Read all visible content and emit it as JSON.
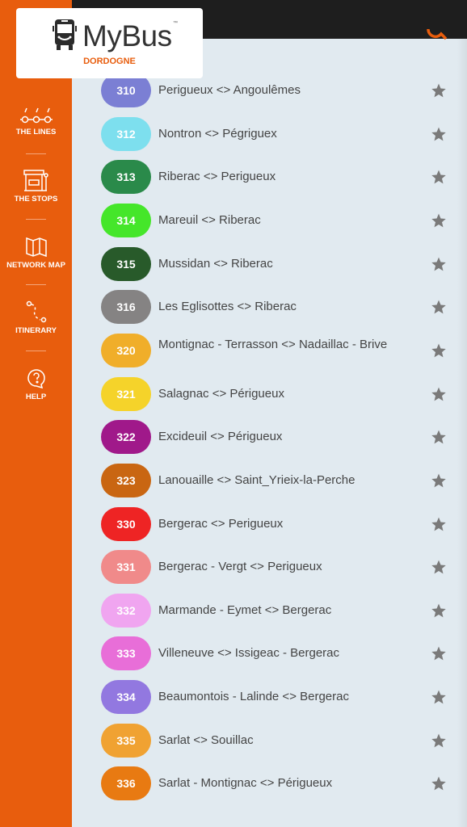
{
  "brand": {
    "name": "MyBus",
    "tm": "™",
    "region": "DORDOGNE"
  },
  "sidebar": {
    "items": [
      {
        "label": "THE LINES",
        "icon": "lines-icon"
      },
      {
        "label": "THE STOPS",
        "icon": "bus-stop-icon"
      },
      {
        "label": "NETWORK MAP",
        "icon": "map-icon"
      },
      {
        "label": "ITINERARY",
        "icon": "route-icon"
      },
      {
        "label": "HELP",
        "icon": "help-icon"
      }
    ]
  },
  "colors": {
    "accent": "#e85d0d",
    "star": "#7a7a7a"
  },
  "lines": [
    {
      "number": "310",
      "name": "Perigueux <> Angoulêmes",
      "color": "#7b7fd4"
    },
    {
      "number": "312",
      "name": "Nontron <> Pégriguex",
      "color": "#7ddfee"
    },
    {
      "number": "313",
      "name": "Riberac <> Perigueux",
      "color": "#2a8a4a"
    },
    {
      "number": "314",
      "name": "Mareuil <> Riberac",
      "color": "#45e62a"
    },
    {
      "number": "315",
      "name": "Mussidan <> Riberac",
      "color": "#285a2a"
    },
    {
      "number": "316",
      "name": "Les Eglisottes <> Riberac",
      "color": "#858383"
    },
    {
      "number": "320",
      "name": "Montignac - Terrasson <> Nadaillac - Brive",
      "color": "#f0ae2a"
    },
    {
      "number": "321",
      "name": "Salagnac <> Périgueux",
      "color": "#f5d32a"
    },
    {
      "number": "322",
      "name": "Excideuil <> Périgueux",
      "color": "#a0198a"
    },
    {
      "number": "323",
      "name": "Lanouaille <> Saint_Yrieix-la-Perche",
      "color": "#c96612"
    },
    {
      "number": "330",
      "name": "Bergerac <> Perigueux",
      "color": "#ee2424"
    },
    {
      "number": "331",
      "name": "Bergerac - Vergt <> Perigueux",
      "color": "#f08a8a"
    },
    {
      "number": "332",
      "name": "Marmande - Eymet <> Bergerac",
      "color": "#f0a5f0"
    },
    {
      "number": "333",
      "name": "Villeneuve <> Issigeac - Bergerac",
      "color": "#e86ed8"
    },
    {
      "number": "334",
      "name": "Beaumontois - Lalinde <> Bergerac",
      "color": "#9278e0"
    },
    {
      "number": "335",
      "name": "Sarlat <> Souillac",
      "color": "#f0a232"
    },
    {
      "number": "336",
      "name": "Sarlat - Montignac <> Périgueux",
      "color": "#e87a12"
    }
  ]
}
